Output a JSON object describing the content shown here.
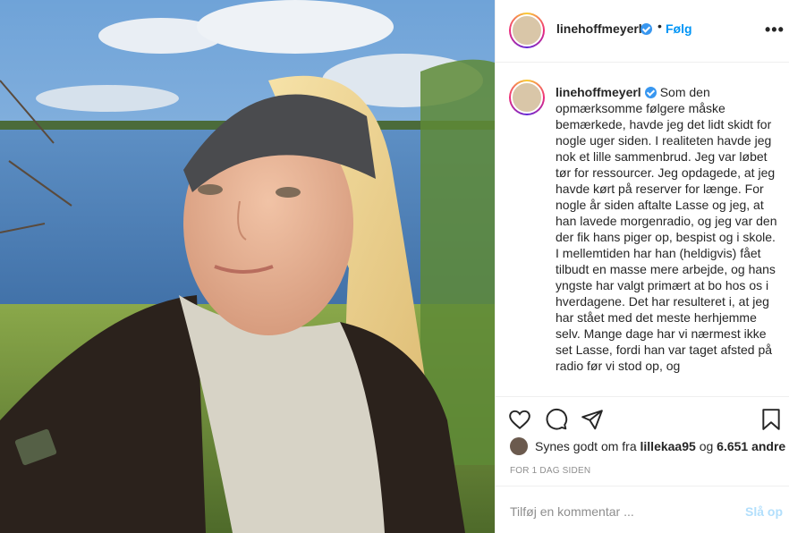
{
  "post": {
    "username": "linehoffmeyerl",
    "follow_label": "Følg",
    "dot": "•",
    "more_icon": "more-horizontal-icon"
  },
  "caption": {
    "username": "linehoffmeyerl",
    "text": "Som den opmærksomme følgere måske bemærkede, havde jeg det lidt skidt for nogle uger siden. I realiteten havde jeg nok et lille sammenbrud. Jeg var løbet tør for ressourcer. Jeg opdagede, at jeg havde kørt på reserver for længe. For nogle år siden aftalte Lasse og jeg, at han lavede morgenradio, og jeg var den der fik hans piger op, bespist og i skole. I mellemtiden har han (heldigvis) fået tilbudt en masse mere arbejde, og hans yngste har valgt primært at bo hos os i hverdagene. Det har resulteret i, at jeg har stået med det meste herhjemme selv. Mange dage har vi nærmest ikke set Lasse, fordi han var taget afsted på radio før vi stod op, og"
  },
  "likes": {
    "prefix": "Synes godt om fra",
    "user": "lillekaa95",
    "conjunction": "og",
    "others": "6.651 andre"
  },
  "timestamp": "FOR 1 DAG SIDEN",
  "comment": {
    "placeholder": "Tilføj en kommentar ...",
    "post_label": "Slå op"
  },
  "colors": {
    "accent": "#0095f6",
    "verified": "#3897f0",
    "post_disabled": "#b2dffc",
    "muted": "#8e8e8e",
    "border": "#efefef"
  }
}
